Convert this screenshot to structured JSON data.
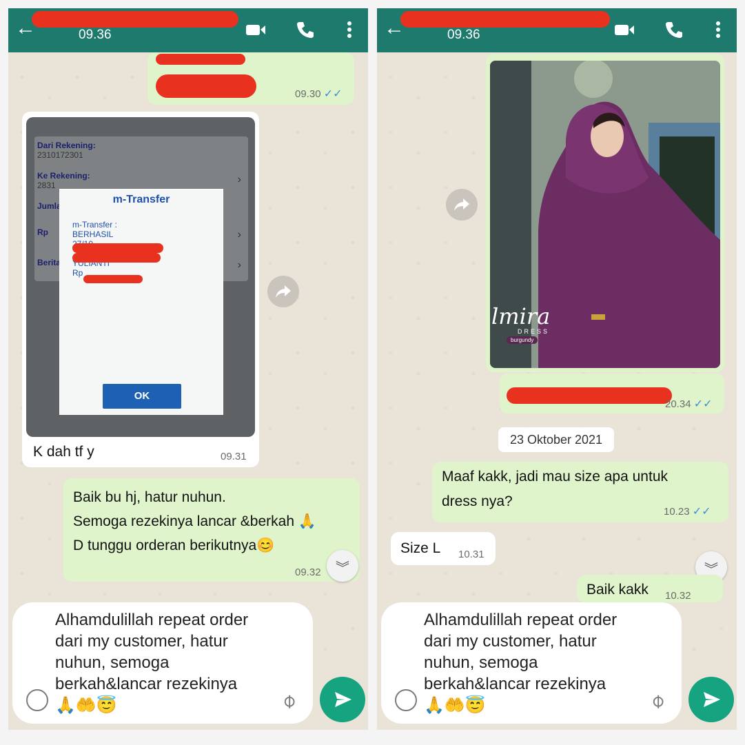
{
  "left": {
    "header": {
      "time": "09.36"
    },
    "top_message": {
      "time": "09.30",
      "ticks": "✓✓"
    },
    "screenshot": {
      "rows": [
        {
          "label": "Dari Rekening:",
          "value": "2310172301"
        },
        {
          "label": "Ke Rekening:",
          "value": "2831"
        },
        {
          "label": "Jumla",
          "value": ""
        },
        {
          "label": "Rp",
          "value": ""
        },
        {
          "label": "Berita",
          "value": ""
        }
      ],
      "dialog": {
        "title": "m-Transfer",
        "lines": [
          "m-Transfer :",
          "BERHASIL",
          "27/10",
          "YULIANTI",
          "Rp"
        ],
        "ok_label": "OK"
      }
    },
    "caption": {
      "text": "K dah tf y",
      "time": "09.31"
    },
    "reply": {
      "line1": "Baik bu hj, hatur nuhun.",
      "line2": "Semoga rezekinya lancar &berkah 🙏",
      "line3": "D tunggu orderan berikutnya😊",
      "time": "09.32"
    },
    "input": {
      "text": "Alhamdulillah repeat order dari my customer, hatur nuhun, semoga berkah&lancar rezekinya",
      "emojis": "🙏🤲😇"
    }
  },
  "right": {
    "header": {
      "time": "09.36"
    },
    "photo": {
      "brand": "lmira",
      "sub": "DRESS",
      "variant": "burgundy"
    },
    "after_photo": {
      "time": "20.34",
      "ticks": "✓✓"
    },
    "date_chip": "23 Oktober 2021",
    "msg1": {
      "line1": "Maaf kakk,  jadi mau size apa untuk",
      "line2": "dress nya?",
      "time": "10.23",
      "ticks": "✓✓"
    },
    "msg2": {
      "text": "Size L",
      "time": "10.31"
    },
    "msg3": {
      "text": "Baik kakk",
      "time": "10.32"
    },
    "input": {
      "text": "Alhamdulillah repeat order dari my customer, hatur nuhun, semoga berkah&lancar rezekinya",
      "emojis": "🙏🤲😇"
    }
  },
  "colors": {
    "header": "#1f7a6e",
    "outgoing": "#e0f4cb",
    "incoming": "#ffffff",
    "send": "#16a37f",
    "redaction": "#e8311f",
    "ticks": "#3b8fd6"
  },
  "icons": [
    "back-arrow-icon",
    "video-call-icon",
    "voice-call-icon",
    "more-vert-icon",
    "forward-icon",
    "chevron-down-icon",
    "emoji-icon",
    "attach-icon",
    "send-icon"
  ]
}
